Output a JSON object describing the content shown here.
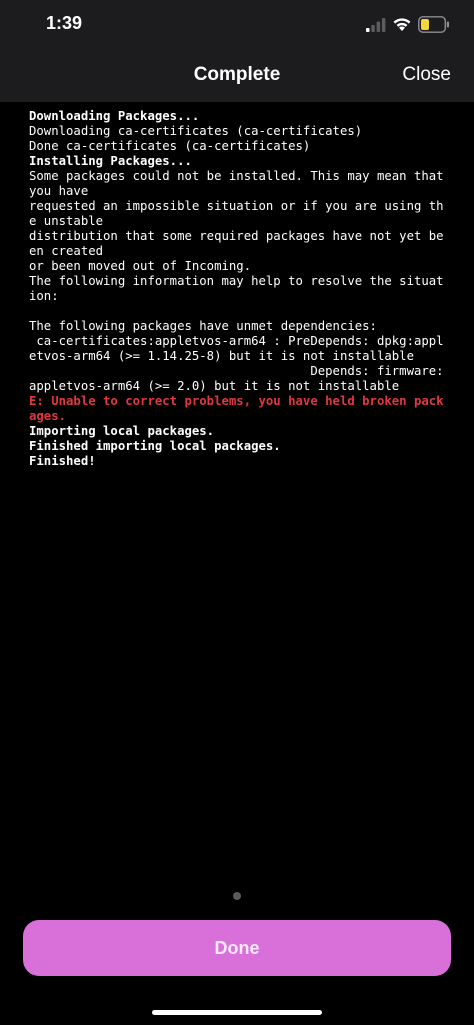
{
  "status_bar": {
    "time": "1:39",
    "icons": [
      "signal-icon",
      "wifi-icon",
      "battery-icon"
    ],
    "battery_color": "#f5d63a"
  },
  "nav": {
    "title": "Complete",
    "close_label": "Close"
  },
  "console": {
    "lines": [
      {
        "text": "Downloading Packages...",
        "style": "bold"
      },
      {
        "text": "Downloading ca-certificates (ca-certificates)",
        "style": "normal"
      },
      {
        "text": "Done ca-certificates (ca-certificates)",
        "style": "normal"
      },
      {
        "text": "Installing Packages...",
        "style": "bold"
      },
      {
        "text": "Some packages could not be installed. This may mean that you have",
        "style": "normal"
      },
      {
        "text": "requested an impossible situation or if you are using the unstable",
        "style": "normal"
      },
      {
        "text": "distribution that some required packages have not yet been created",
        "style": "normal"
      },
      {
        "text": "or been moved out of Incoming.",
        "style": "normal"
      },
      {
        "text": "The following information may help to resolve the situation:",
        "style": "normal"
      },
      {
        "text": "",
        "style": "normal"
      },
      {
        "text": "The following packages have unmet dependencies:",
        "style": "normal"
      },
      {
        "text": " ca-certificates:appletvos-arm64 : PreDepends: dpkg:appletvos-arm64 (>= 1.14.25-8) but it is not installable",
        "style": "normal"
      },
      {
        "text": "                                      Depends: firmware:appletvos-arm64 (>= 2.0) but it is not installable",
        "style": "normal"
      },
      {
        "text": "E: Unable to correct problems, you have held broken packages.",
        "style": "error"
      },
      {
        "text": "Importing local packages.",
        "style": "bold"
      },
      {
        "text": "Finished importing local packages.",
        "style": "bold"
      },
      {
        "text": "Finished!",
        "style": "bold"
      }
    ],
    "error_color": "#e0383e"
  },
  "footer": {
    "done_label": "Done",
    "button_color": "#d96fd9"
  }
}
